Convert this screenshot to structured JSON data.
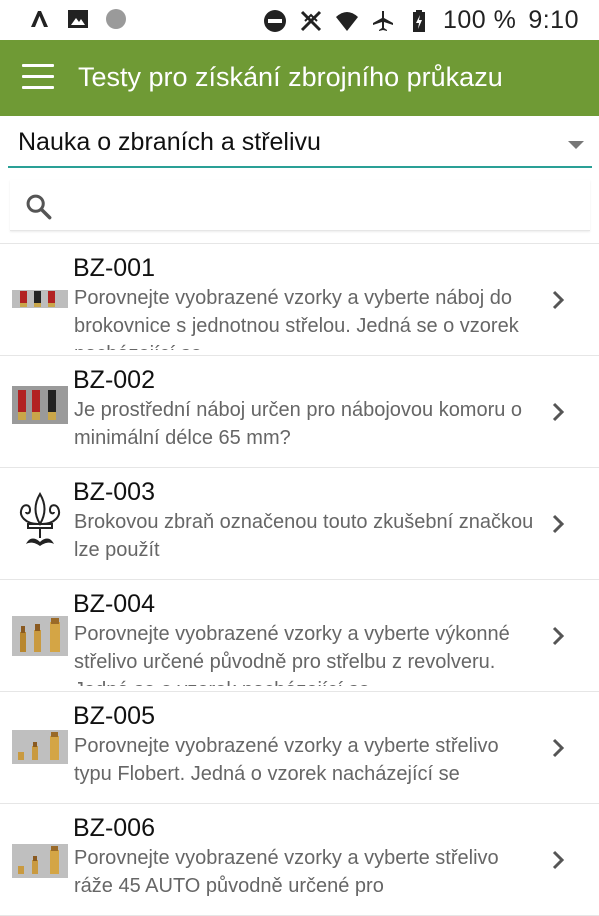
{
  "status_bar": {
    "battery": "100 %",
    "time": "9:10",
    "icons": [
      "vpn-icon",
      "image-icon",
      "circle-icon",
      "do-not-disturb-icon",
      "no-signal-icon",
      "wifi-icon",
      "airplane-icon",
      "battery-charging-icon"
    ]
  },
  "app_bar": {
    "title": "Testy pro získání zbrojního průkazu",
    "menu_icon": "hamburger-menu-icon"
  },
  "category_select": {
    "selected": "Nauka o zbraních a střelivu"
  },
  "search": {
    "placeholder": "",
    "value": ""
  },
  "questions": [
    {
      "code": "BZ-001",
      "text": "Porovnejte vyobrazené vzorky a vyberte náboj do brokovnice s jednotnou střelou. Jedná se o vzorek nacházející se",
      "thumb": "shotgun-shells-thumbnail"
    },
    {
      "code": "BZ-002",
      "text": "Je prostřední náboj určen pro nábojovou komoru o minimální délce 65 mm?",
      "thumb": "shotgun-shells-thumbnail"
    },
    {
      "code": "BZ-003",
      "text": "Brokovou zbraň označenou touto zkušební značkou lze použít",
      "thumb": "proof-mark-fleur-de-lis"
    },
    {
      "code": "BZ-004",
      "text": "Porovnejte vyobrazené vzorky a vyberte výkonné střelivo určené původně pro střelbu z revolveru. Jedná se o vzorek nacházející se",
      "thumb": "cartridges-thumbnail"
    },
    {
      "code": "BZ-005",
      "text": "Porovnejte vyobrazené vzorky a vyberte střelivo typu Flobert. Jedná o vzorek nacházející se",
      "thumb": "cartridges-thumbnail"
    },
    {
      "code": "BZ-006",
      "text": "Porovnejte vyobrazené vzorky a vyberte střelivo ráže 45 AUTO původně určené pro",
      "thumb": "cartridges-thumbnail"
    }
  ],
  "colors": {
    "app_bar": "#6f9a35",
    "select_underline": "#2aa096",
    "code_text": "#111111",
    "desc_text": "#666666"
  }
}
